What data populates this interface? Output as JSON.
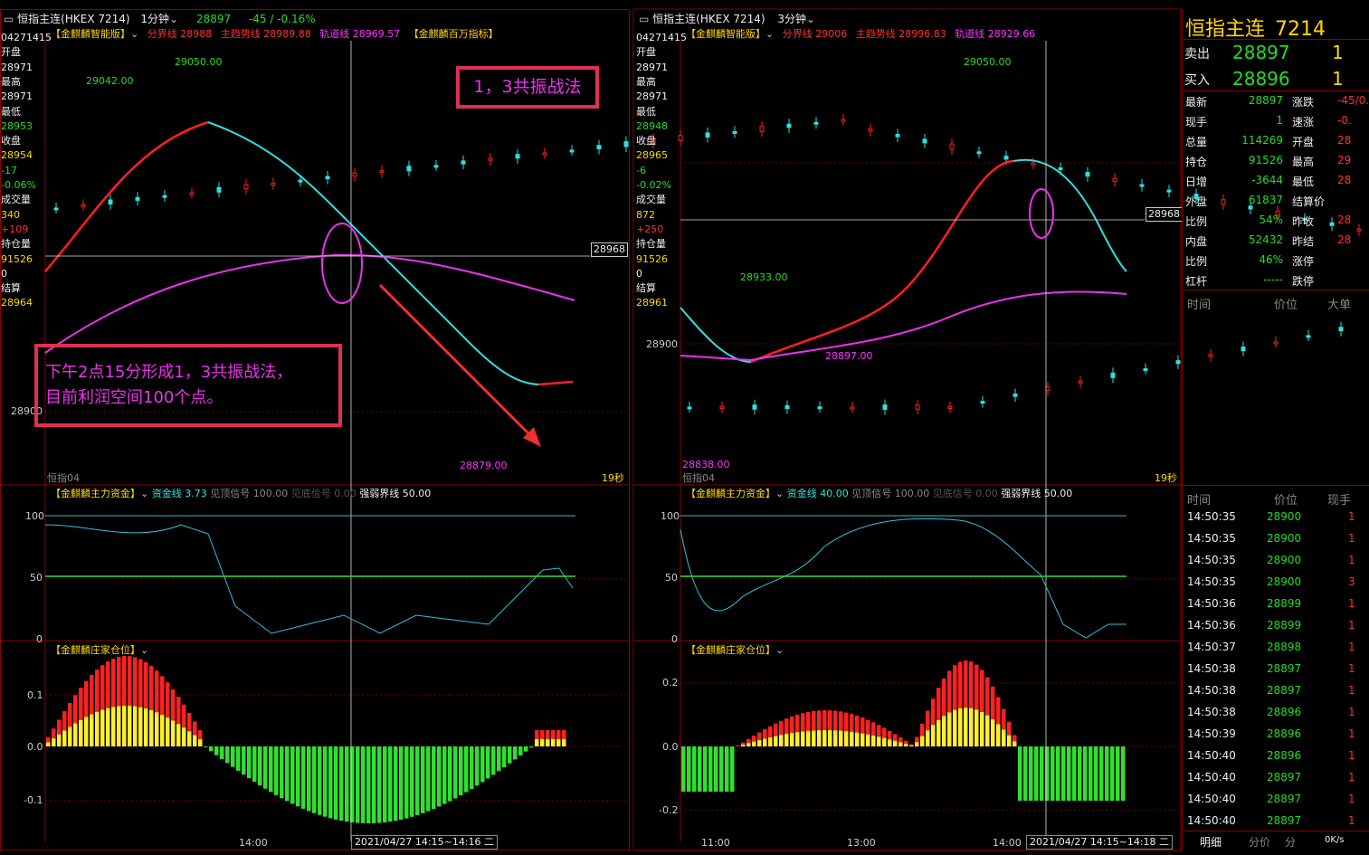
{
  "left_chart": {
    "title": "恒指主连(HKEX 7214)",
    "period": "1分钟",
    "price": "28897",
    "change": "-45 / -0.16%",
    "indicator": "【金麒麟智能版】",
    "fenjie": "分界线 28988",
    "zhuqushi": "主趋势线 28989.88",
    "guidao": "轨道线 28969.57",
    "extra": "【金麒麟百万指标】",
    "side": [
      "04271415",
      "开盘",
      "28971",
      "最高",
      "28971",
      "最低",
      "28953",
      "收盘",
      "28954",
      "-17",
      "-0.06%",
      "成交量",
      "340",
      "+109",
      "持仓量",
      "91526",
      "0",
      "结算",
      "28964"
    ],
    "price_marks": [
      "29042.00",
      "29050.00",
      "28879.00"
    ],
    "cursor_price": "28968",
    "ylabel": "28900",
    "ylabel_top": "恒指04",
    "secs": "19秒",
    "annotation_title": "1，3共振战法",
    "annotation_body_1": "下午2点15分形成1，3共振战法，",
    "annotation_body_2": "目前利润空间100个点。",
    "fund_title": "【金麒麟主力资金】",
    "fund_line": "资金线 3.73",
    "fund_top": "见顶信号 100.00",
    "fund_bottom": "见底信号 0.00",
    "fund_strong": "强弱界线 50.00",
    "fund_ticks": [
      "100",
      "50",
      "0"
    ],
    "pos_title": "【金麒麟庄家仓位】",
    "pos_ticks": [
      "0.1",
      "0.0",
      "-0.1"
    ],
    "time_tick": "14:00",
    "time_range": "2021/04/27 14:15~14:16 二"
  },
  "right_chart": {
    "title": "恒指主连(HKEX 7214)",
    "period": "3分钟",
    "fenjie": "分界线 29006",
    "zhuqushi": "主趋势线 28996.83",
    "guidao": "轨道线 28929.66",
    "indicator": "【金麒麟智能版】",
    "side": [
      "04271415",
      "开盘",
      "28971",
      "最高",
      "28971",
      "最低",
      "28948",
      "收盘",
      "28965",
      "-6",
      "-0.02%",
      "成交量",
      "872",
      "+250",
      "持仓量",
      "91526",
      "0",
      "结算",
      "28961"
    ],
    "price_marks": [
      "29050.00",
      "28933.00",
      "28897.00",
      "28838.00"
    ],
    "cursor_price": "28968",
    "ylabel": "28900",
    "ylabel_top": "恒指04",
    "secs": "19秒",
    "fund_title": "【金麒麟主力资金】",
    "fund_line": "资金线 40.00",
    "fund_top": "见顶信号 100.00",
    "fund_bottom": "见底信号 0.00",
    "fund_strong": "强弱界线 50.00",
    "fund_ticks": [
      "100",
      "50",
      "0"
    ],
    "pos_title": "【金麒麟庄家仓位】",
    "pos_ticks": [
      "0.2",
      "0.0",
      "-0.2"
    ],
    "time_ticks": [
      "11:00",
      "13:00",
      "14:00"
    ],
    "time_range": "2021/04/27 14:15~14:18 二"
  },
  "quote": {
    "title": "恒指主连",
    "code": "7214",
    "sell_label": "卖出",
    "sell_price": "28897",
    "sell_vol": "1",
    "buy_label": "买入",
    "buy_price": "28896",
    "buy_vol": "1",
    "rows": [
      [
        "最新",
        "28897",
        "涨跌",
        "-45/0."
      ],
      [
        "现手",
        "1",
        "速涨",
        "-0."
      ],
      [
        "总量",
        "114269",
        "开盘",
        "28"
      ],
      [
        "持仓",
        "91526",
        "最高",
        "29"
      ],
      [
        "日增",
        "-3644",
        "最低",
        "28"
      ],
      [
        "外盘",
        "61837",
        "结算价",
        ""
      ],
      [
        "比例",
        "54%",
        "昨收",
        "28"
      ],
      [
        "内盘",
        "52432",
        "昨结",
        "28"
      ],
      [
        "比例",
        "46%",
        "涨停",
        ""
      ],
      [
        "杠杆",
        "-----",
        "跌停",
        ""
      ]
    ],
    "h1": [
      "时间",
      "价位",
      "大单"
    ],
    "h2": [
      "时间",
      "价位",
      "现手"
    ],
    "ticks": [
      [
        "14:50:35",
        "28900",
        "1"
      ],
      [
        "14:50:35",
        "28900",
        "1"
      ],
      [
        "14:50:35",
        "28900",
        "1"
      ],
      [
        "14:50:35",
        "28900",
        "3"
      ],
      [
        "14:50:36",
        "28899",
        "1"
      ],
      [
        "14:50:36",
        "28899",
        "1"
      ],
      [
        "14:50:37",
        "28898",
        "1"
      ],
      [
        "14:50:38",
        "28897",
        "1"
      ],
      [
        "14:50:38",
        "28897",
        "1"
      ],
      [
        "14:50:38",
        "28896",
        "1"
      ],
      [
        "14:50:39",
        "28896",
        "1"
      ],
      [
        "14:50:40",
        "28896",
        "1"
      ],
      [
        "14:50:40",
        "28897",
        "1"
      ],
      [
        "14:50:40",
        "28897",
        "1"
      ],
      [
        "14:50:40",
        "28897",
        "1"
      ]
    ],
    "tabs": [
      "明细",
      "分价",
      "分"
    ],
    "net": "0K/s"
  },
  "chart_data": [
    {
      "type": "line",
      "title": "恒指主连 1分钟",
      "ylim": [
        28870,
        29060
      ],
      "series": [
        {
          "name": "主趋势线",
          "values": [
            28945,
            28990,
            29020,
            28985,
            28955,
            28935,
            28925,
            28910
          ]
        },
        {
          "name": "轨道线",
          "values": [
            28900,
            28945,
            28965,
            28970,
            28965,
            28955,
            28950
          ]
        }
      ]
    },
    {
      "type": "line",
      "title": "恒指主连 3分钟",
      "ylim": [
        28830,
        29060
      ],
      "series": [
        {
          "name": "主趋势线",
          "values": [
            28910,
            28905,
            28925,
            28960,
            29020,
            28990
          ]
        },
        {
          "name": "轨道线",
          "values": [
            28910,
            28915,
            28925,
            28945,
            28950,
            28950
          ]
        }
      ]
    }
  ]
}
